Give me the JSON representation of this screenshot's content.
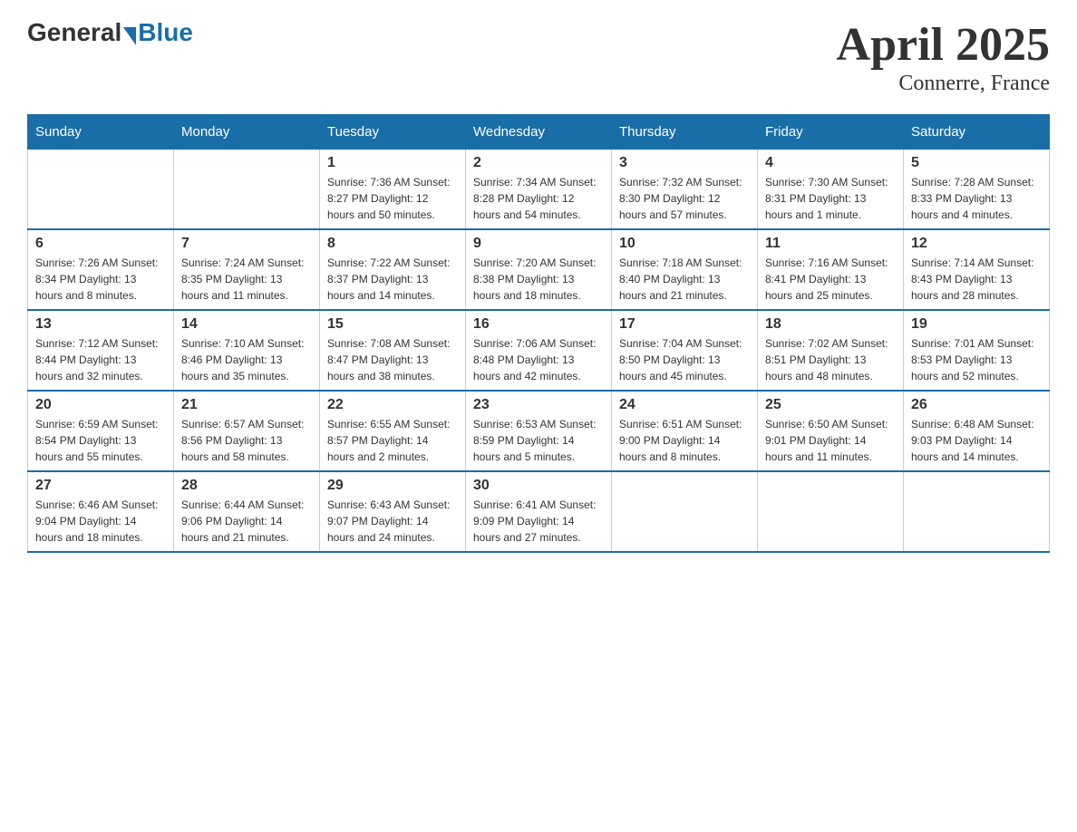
{
  "logo": {
    "general": "General",
    "blue": "Blue"
  },
  "title": "April 2025",
  "location": "Connerre, France",
  "days_header": [
    "Sunday",
    "Monday",
    "Tuesday",
    "Wednesday",
    "Thursday",
    "Friday",
    "Saturday"
  ],
  "weeks": [
    [
      {
        "day": "",
        "info": ""
      },
      {
        "day": "",
        "info": ""
      },
      {
        "day": "1",
        "info": "Sunrise: 7:36 AM\nSunset: 8:27 PM\nDaylight: 12 hours\nand 50 minutes."
      },
      {
        "day": "2",
        "info": "Sunrise: 7:34 AM\nSunset: 8:28 PM\nDaylight: 12 hours\nand 54 minutes."
      },
      {
        "day": "3",
        "info": "Sunrise: 7:32 AM\nSunset: 8:30 PM\nDaylight: 12 hours\nand 57 minutes."
      },
      {
        "day": "4",
        "info": "Sunrise: 7:30 AM\nSunset: 8:31 PM\nDaylight: 13 hours\nand 1 minute."
      },
      {
        "day": "5",
        "info": "Sunrise: 7:28 AM\nSunset: 8:33 PM\nDaylight: 13 hours\nand 4 minutes."
      }
    ],
    [
      {
        "day": "6",
        "info": "Sunrise: 7:26 AM\nSunset: 8:34 PM\nDaylight: 13 hours\nand 8 minutes."
      },
      {
        "day": "7",
        "info": "Sunrise: 7:24 AM\nSunset: 8:35 PM\nDaylight: 13 hours\nand 11 minutes."
      },
      {
        "day": "8",
        "info": "Sunrise: 7:22 AM\nSunset: 8:37 PM\nDaylight: 13 hours\nand 14 minutes."
      },
      {
        "day": "9",
        "info": "Sunrise: 7:20 AM\nSunset: 8:38 PM\nDaylight: 13 hours\nand 18 minutes."
      },
      {
        "day": "10",
        "info": "Sunrise: 7:18 AM\nSunset: 8:40 PM\nDaylight: 13 hours\nand 21 minutes."
      },
      {
        "day": "11",
        "info": "Sunrise: 7:16 AM\nSunset: 8:41 PM\nDaylight: 13 hours\nand 25 minutes."
      },
      {
        "day": "12",
        "info": "Sunrise: 7:14 AM\nSunset: 8:43 PM\nDaylight: 13 hours\nand 28 minutes."
      }
    ],
    [
      {
        "day": "13",
        "info": "Sunrise: 7:12 AM\nSunset: 8:44 PM\nDaylight: 13 hours\nand 32 minutes."
      },
      {
        "day": "14",
        "info": "Sunrise: 7:10 AM\nSunset: 8:46 PM\nDaylight: 13 hours\nand 35 minutes."
      },
      {
        "day": "15",
        "info": "Sunrise: 7:08 AM\nSunset: 8:47 PM\nDaylight: 13 hours\nand 38 minutes."
      },
      {
        "day": "16",
        "info": "Sunrise: 7:06 AM\nSunset: 8:48 PM\nDaylight: 13 hours\nand 42 minutes."
      },
      {
        "day": "17",
        "info": "Sunrise: 7:04 AM\nSunset: 8:50 PM\nDaylight: 13 hours\nand 45 minutes."
      },
      {
        "day": "18",
        "info": "Sunrise: 7:02 AM\nSunset: 8:51 PM\nDaylight: 13 hours\nand 48 minutes."
      },
      {
        "day": "19",
        "info": "Sunrise: 7:01 AM\nSunset: 8:53 PM\nDaylight: 13 hours\nand 52 minutes."
      }
    ],
    [
      {
        "day": "20",
        "info": "Sunrise: 6:59 AM\nSunset: 8:54 PM\nDaylight: 13 hours\nand 55 minutes."
      },
      {
        "day": "21",
        "info": "Sunrise: 6:57 AM\nSunset: 8:56 PM\nDaylight: 13 hours\nand 58 minutes."
      },
      {
        "day": "22",
        "info": "Sunrise: 6:55 AM\nSunset: 8:57 PM\nDaylight: 14 hours\nand 2 minutes."
      },
      {
        "day": "23",
        "info": "Sunrise: 6:53 AM\nSunset: 8:59 PM\nDaylight: 14 hours\nand 5 minutes."
      },
      {
        "day": "24",
        "info": "Sunrise: 6:51 AM\nSunset: 9:00 PM\nDaylight: 14 hours\nand 8 minutes."
      },
      {
        "day": "25",
        "info": "Sunrise: 6:50 AM\nSunset: 9:01 PM\nDaylight: 14 hours\nand 11 minutes."
      },
      {
        "day": "26",
        "info": "Sunrise: 6:48 AM\nSunset: 9:03 PM\nDaylight: 14 hours\nand 14 minutes."
      }
    ],
    [
      {
        "day": "27",
        "info": "Sunrise: 6:46 AM\nSunset: 9:04 PM\nDaylight: 14 hours\nand 18 minutes."
      },
      {
        "day": "28",
        "info": "Sunrise: 6:44 AM\nSunset: 9:06 PM\nDaylight: 14 hours\nand 21 minutes."
      },
      {
        "day": "29",
        "info": "Sunrise: 6:43 AM\nSunset: 9:07 PM\nDaylight: 14 hours\nand 24 minutes."
      },
      {
        "day": "30",
        "info": "Sunrise: 6:41 AM\nSunset: 9:09 PM\nDaylight: 14 hours\nand 27 minutes."
      },
      {
        "day": "",
        "info": ""
      },
      {
        "day": "",
        "info": ""
      },
      {
        "day": "",
        "info": ""
      }
    ]
  ]
}
